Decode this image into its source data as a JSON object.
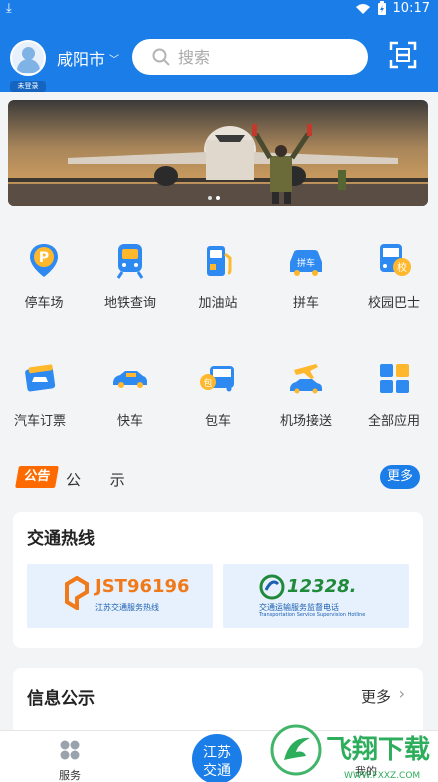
{
  "status_bar": {
    "time": "10:17"
  },
  "header": {
    "login_badge": "未登录",
    "city": "咸阳市",
    "search_placeholder": "搜索"
  },
  "services": [
    {
      "label": "停车场",
      "icon": "parking-icon"
    },
    {
      "label": "地铁查询",
      "icon": "metro-icon"
    },
    {
      "label": "加油站",
      "icon": "gas-station-icon"
    },
    {
      "label": "拼车",
      "icon": "carpool-icon"
    },
    {
      "label": "校园巴士",
      "icon": "school-bus-icon"
    },
    {
      "label": "汽车订票",
      "icon": "bus-ticket-icon"
    },
    {
      "label": "快车",
      "icon": "express-car-icon"
    },
    {
      "label": "包车",
      "icon": "charter-bus-icon"
    },
    {
      "label": "机场接送",
      "icon": "airport-transfer-icon"
    },
    {
      "label": "全部应用",
      "icon": "all-apps-icon"
    }
  ],
  "notice": {
    "tag": "公告",
    "text": "公 示",
    "more": "更多"
  },
  "hotline_card": {
    "title": "交通热线",
    "items": [
      {
        "number": "JST96196",
        "caption": "江苏交通服务热线",
        "color": "#f07a1a"
      },
      {
        "number": "12328.",
        "caption": "交通运输服务监督电话",
        "sub": "Transportation Service Supervision Hotline",
        "color": "#1f8a3a"
      }
    ]
  },
  "info_card": {
    "title": "信息公示",
    "more": "更多"
  },
  "tabbar": {
    "left": "服务",
    "center": [
      "江苏",
      "交通"
    ],
    "right": "我的"
  },
  "watermark": "飞翔下载"
}
